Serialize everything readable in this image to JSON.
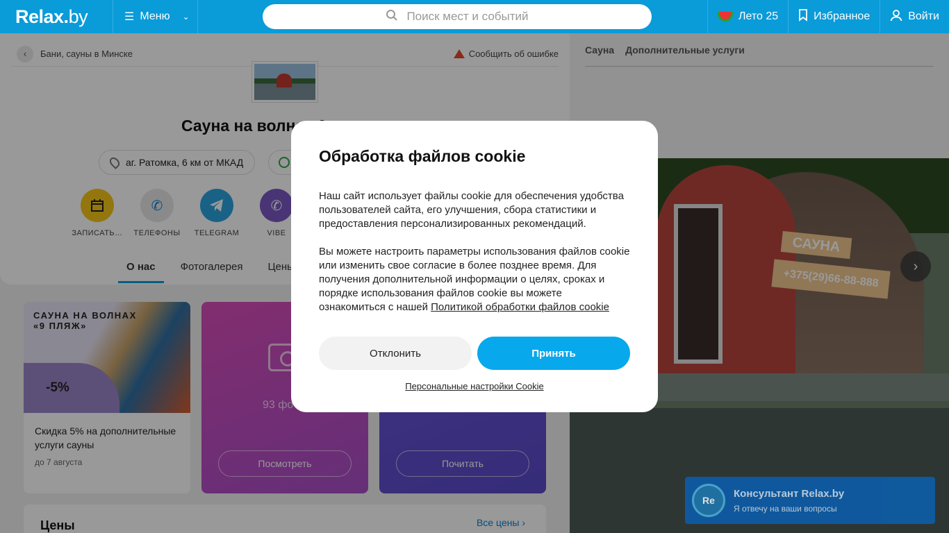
{
  "header": {
    "logo_main": "Relax.",
    "logo_suffix": "by",
    "menu_label": "Меню",
    "search_placeholder": "Поиск мест и событий",
    "summer_label": "Лето 25",
    "favorites_label": "Избранное",
    "login_label": "Войти"
  },
  "breadcrumb": {
    "label": "Бани, сауны в Минске"
  },
  "report_label": "Сообщить об ошибке",
  "place": {
    "title": "Сауна на волнах 9",
    "address": "аг. Ратомка, 6 км от МКАД"
  },
  "actions": [
    {
      "label": "ЗАПИСАТЬ…",
      "icon": "calendar-icon",
      "color": "#f5c518"
    },
    {
      "label": "ТЕЛЕФОНЫ",
      "icon": "phone-icon",
      "color": "#e6e6e6"
    },
    {
      "label": "TELEGRAM",
      "icon": "telegram-icon",
      "color": "#2aa3df"
    },
    {
      "label": "VIBE",
      "icon": "viber-icon",
      "color": "#7b58c4"
    }
  ],
  "tabs": [
    "О нас",
    "Фотогалерея",
    "Цены"
  ],
  "promo": {
    "title": "САУНА НА ВОЛНАХ «9 ПЛЯЖ»",
    "badge": "-5%",
    "text": "Скидка 5% на дополнительные услуги сауны",
    "date": "до 7 августа"
  },
  "photos": {
    "count": "93 фо",
    "button": "Посмотреть"
  },
  "reviews": {
    "button": "Почитать"
  },
  "prices": {
    "title": "Цены",
    "all_label": "Все цены"
  },
  "right_panel": {
    "tabs": [
      "Сауна",
      "Дополнительные услуги"
    ],
    "sign": "САУНА",
    "phone": "+375(29)66-88-888"
  },
  "cookie_modal": {
    "title": "Обработка файлов cookie",
    "p1": "Наш сайт использует файлы cookie для обеспечения удобства пользователей сайта, его улучшения, сбора статистики и предоставления персонализированных рекомендаций.",
    "p2": "Вы можете настроить параметры использования файлов cookie или изменить свое согласие в более позднее время. Для получения дополнительной информации о целях, сроках и порядке использования файлов cookie вы можете ознакомиться с нашей ",
    "policy_link": "Политикой обработки файлов cookie",
    "decline": "Отклонить",
    "accept": "Принять",
    "settings": "Персональные настройки Cookie"
  },
  "consultant": {
    "avatar": "Re",
    "name": "Консультант Relax.by",
    "subtitle": "Я отвечу на ваши вопросы"
  },
  "colors": {
    "brand": "#0a9bd9",
    "accept": "#08a8ec"
  }
}
